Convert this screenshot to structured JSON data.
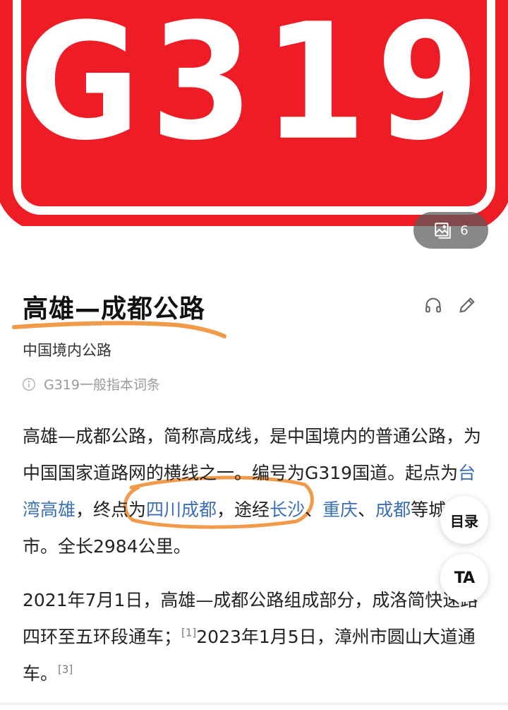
{
  "hero": {
    "sign_text": "G319",
    "image_count": "6",
    "sign_color": "#ee1c25"
  },
  "article": {
    "title": "高雄—成都公路",
    "subtitle": "中国境内公路",
    "notice": "G319一般指本词条",
    "p1": {
      "t1": "高雄—成都公路，简称高成线，是中国境内的普通公路，为中国国家道路网的横线之一。编号为G319国道。",
      "t2": "起点为",
      "link_taiwan": "台湾高雄",
      "t3": "，终点为",
      "link_sichuan": "四川成都",
      "t4": "，途经",
      "link_changsha": "长沙",
      "t5": "、",
      "link_chongqing": "重庆",
      "t6": "、",
      "link_chengdu": "成都",
      "t7": "等城市。全长2984公里。"
    },
    "p2": {
      "t1": "2021年7月1日，高雄—成都公路组成部分，成洛简快速路四环至五环段通车；",
      "ref1": "[1]",
      "t2": "2023年1月5日，漳州市圆山大道通车。",
      "ref2": "[3]"
    }
  },
  "buttons": {
    "toc": "目录",
    "text_size": "TA"
  },
  "icons": {
    "image": "image-gallery-icon",
    "listen": "headphones-icon",
    "edit": "pencil-icon",
    "info": "info-icon"
  },
  "annotation_color": "#f09a4a",
  "link_color": "#3b6fb6"
}
